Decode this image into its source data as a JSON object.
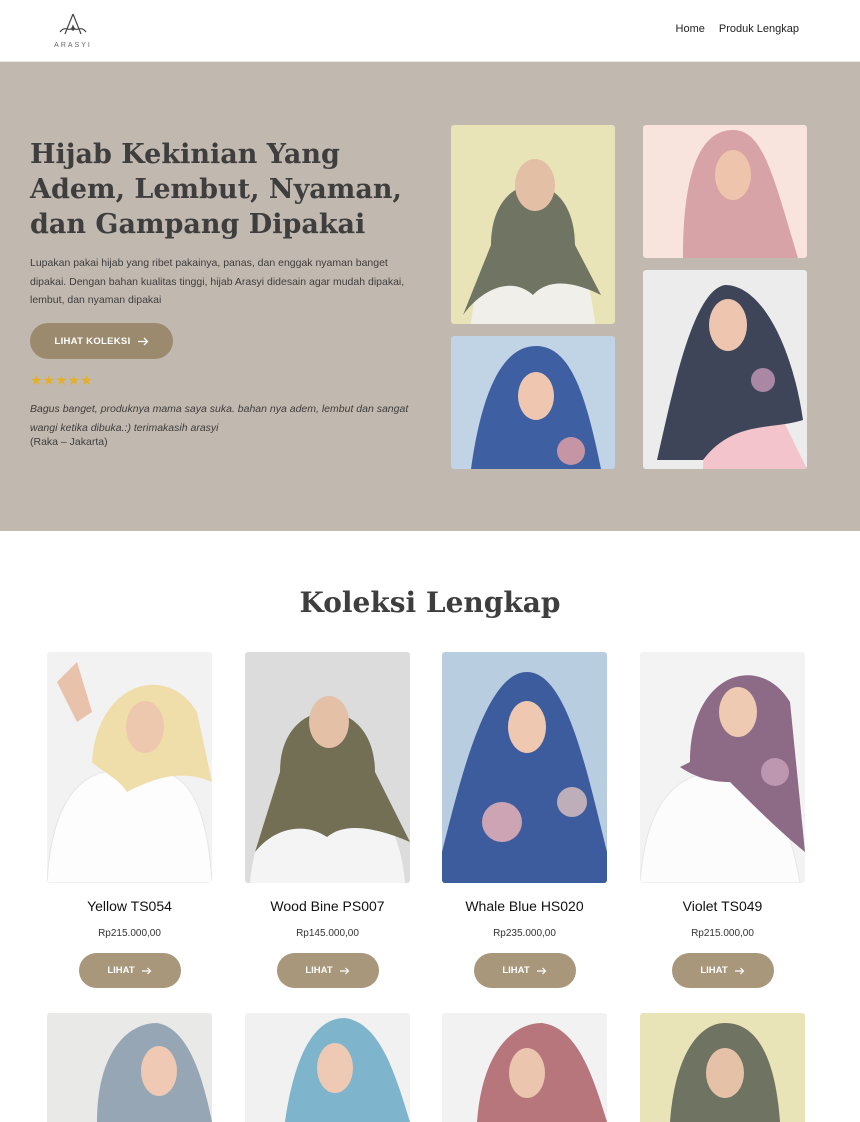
{
  "brand": {
    "logo_text": "ARASYI"
  },
  "nav": {
    "items": [
      "Home",
      "Produk Lengkap"
    ]
  },
  "hero": {
    "title": "Hijab Kekinian Yang Adem, Lembut, Nyaman, dan Gampang Dipakai",
    "description": "Lupakan pakai hijab yang ribet pakainya, panas, dan enggak nyaman banget dipakai. Dengan bahan kualitas tinggi, hijab Arasyi didesain agar mudah dipakai, lembut, dan nyaman dipakai",
    "cta_label": "LIHAT KOLEKSI",
    "rating": "★★★★★",
    "testimonial": "Bagus banget, produknya mama saya suka. bahan nya adem, lembut dan sangat wangi ketika dibuka.:) terimakasih arasyi",
    "testimonial_author": "(Raka – Jakarta)"
  },
  "collection": {
    "title": "Koleksi Lengkap",
    "button_label": "LIHAT",
    "products": [
      {
        "name": "Yellow TS054",
        "price": "Rp215.000,00"
      },
      {
        "name": "Wood Bine PS007",
        "price": "Rp145.000,00"
      },
      {
        "name": "Whale Blue HS020",
        "price": "Rp235.000,00"
      },
      {
        "name": "Violet TS049",
        "price": "Rp215.000,00"
      }
    ]
  },
  "colors": {
    "hero_bg": "#c1b8af",
    "accent": "#9c8a6e",
    "star": "#e3b02a",
    "heading": "#3e3e3e"
  },
  "icons": [
    "arasyi-logo",
    "arrow-right-icon",
    "star-icon"
  ]
}
